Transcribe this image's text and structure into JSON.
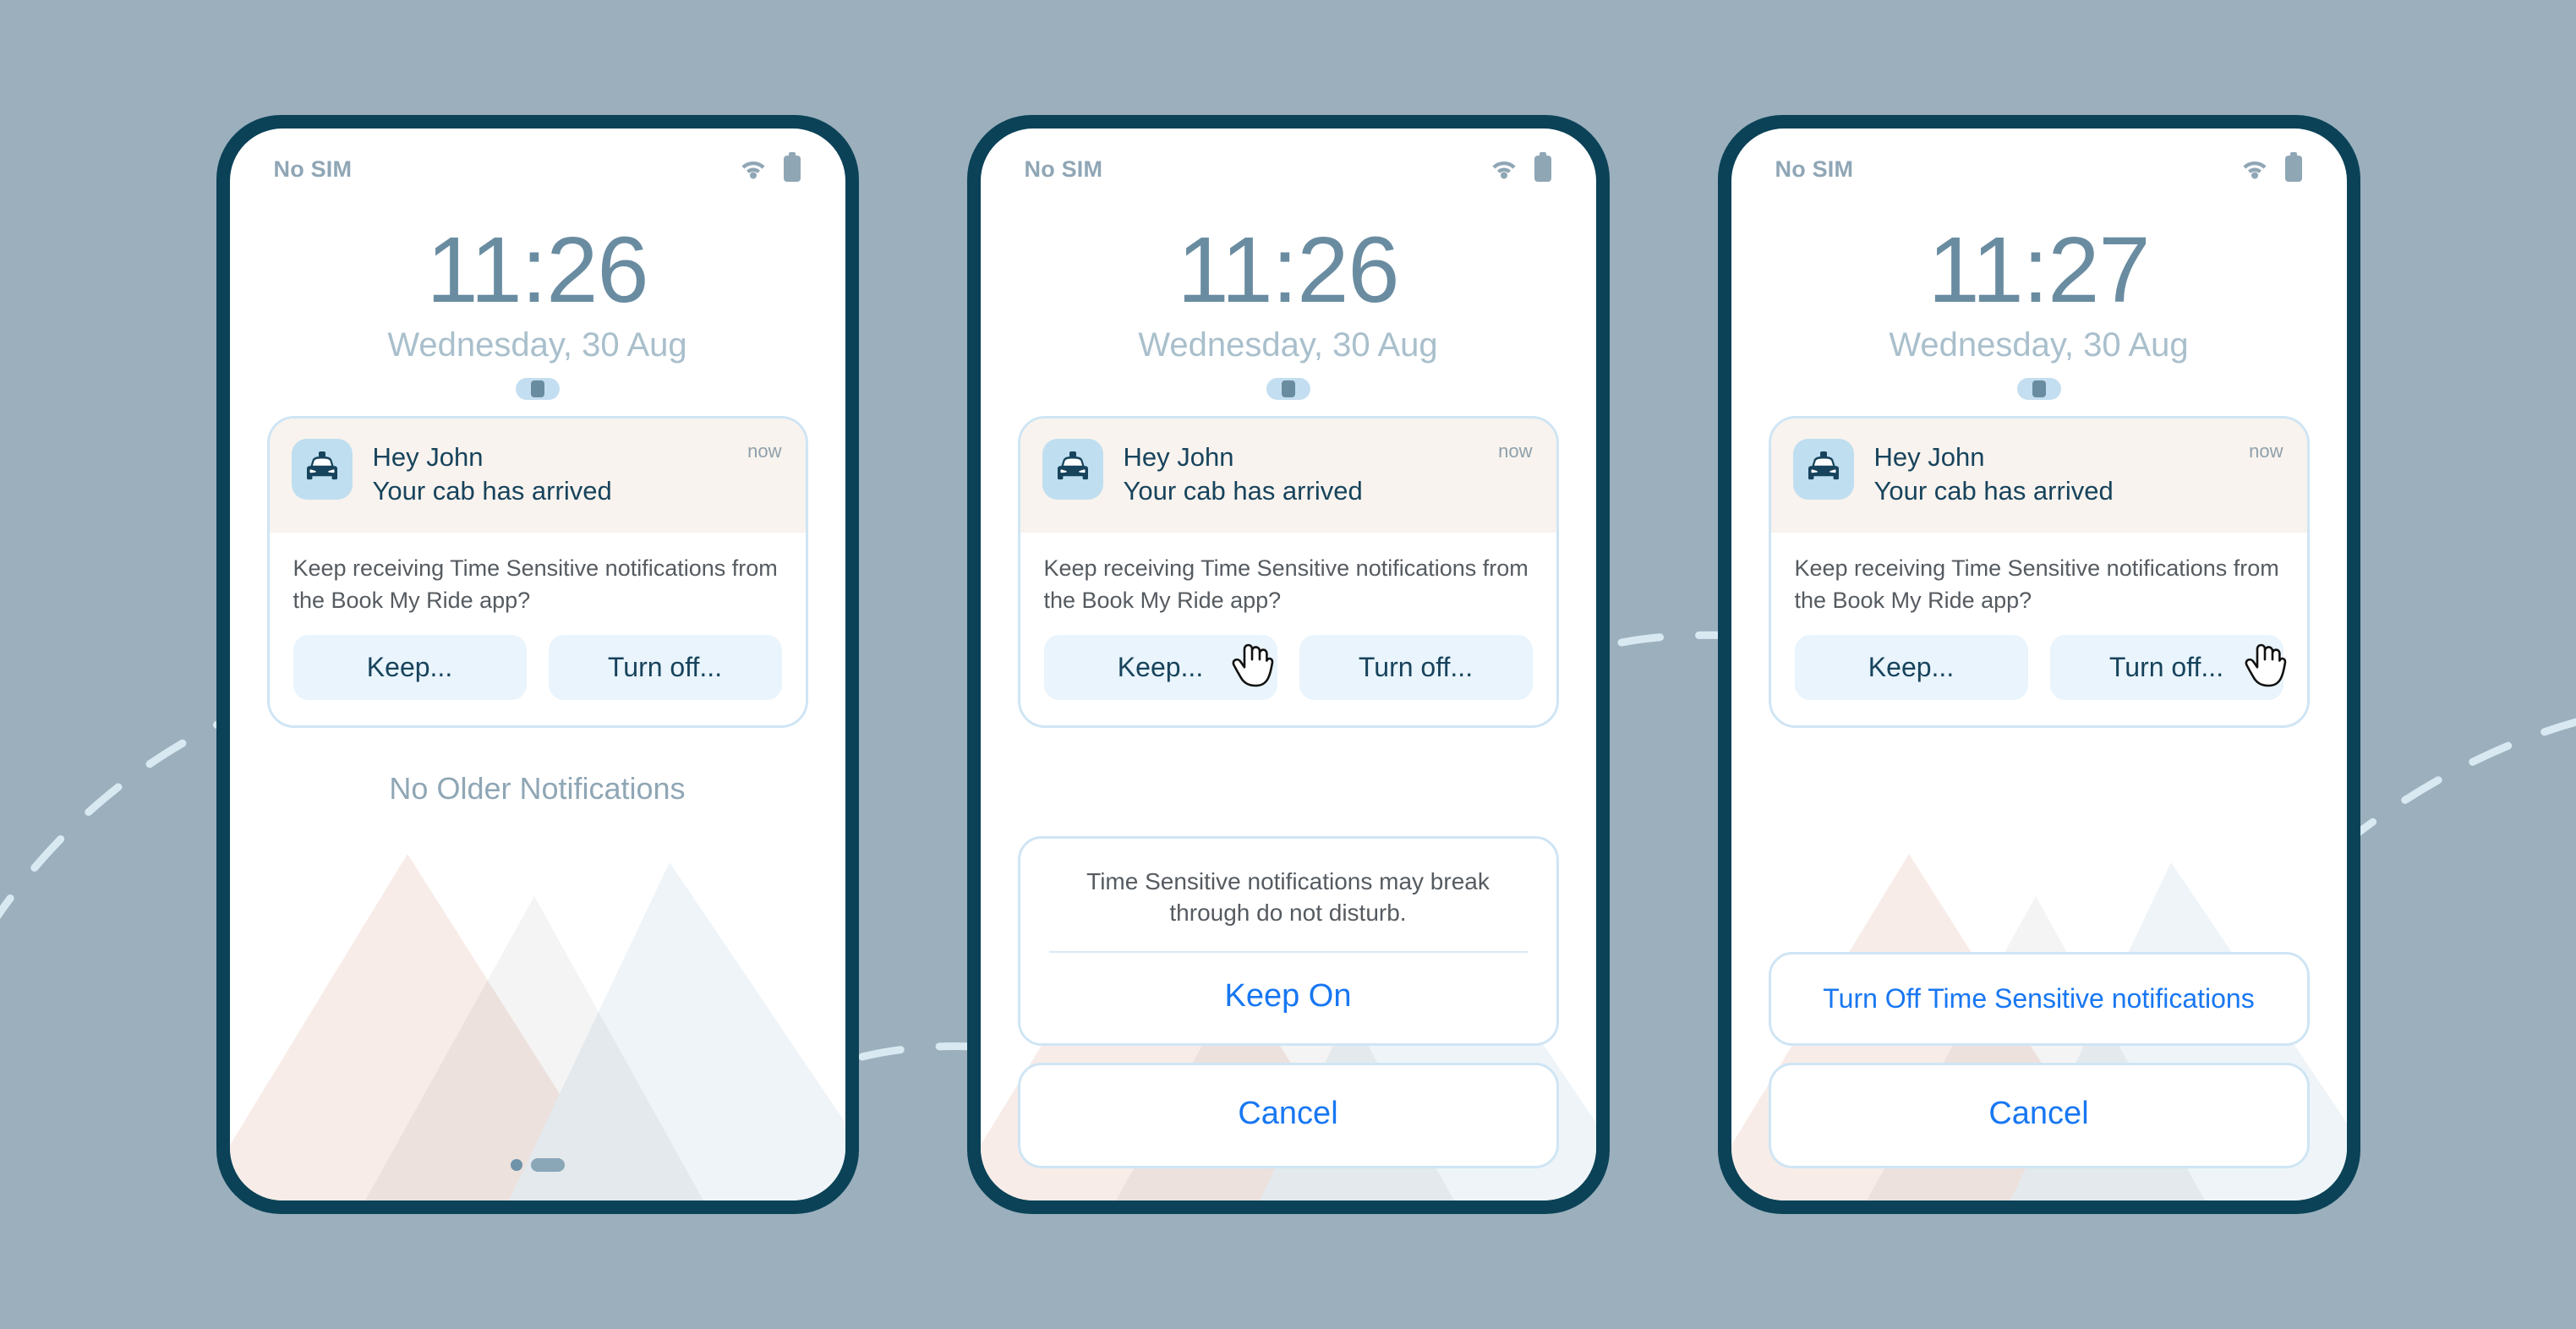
{
  "background": {
    "color": "#9bafbd",
    "accent_frame": "#0b4257",
    "dash_color": "#d8e9f2"
  },
  "phones": [
    {
      "id": "phone-initial",
      "status": {
        "carrier": "No SIM",
        "wifi_icon": "wifi-icon",
        "battery_icon": "battery-icon"
      },
      "lock": {
        "time": "11:26",
        "date": "Wednesday, 30 Aug"
      },
      "notification": {
        "app_icon": "taxi-icon",
        "title": "Hey John",
        "body": "Your cab has arrived",
        "time": "now",
        "prompt": "Keep receiving Time Sensitive notifications from the Book My Ride app?",
        "actions": [
          "Keep...",
          "Turn off..."
        ]
      },
      "empty_state": "No Older Notifications",
      "sheets": [],
      "cursor": null,
      "show_home_dots": true
    },
    {
      "id": "phone-keep-sheet",
      "status": {
        "carrier": "No SIM",
        "wifi_icon": "wifi-icon",
        "battery_icon": "battery-icon"
      },
      "lock": {
        "time": "11:26",
        "date": "Wednesday, 30 Aug"
      },
      "notification": {
        "app_icon": "taxi-icon",
        "title": "Hey John",
        "body": "Your cab has arrived",
        "time": "now",
        "prompt": "Keep receiving Time Sensitive notifications from the Book My Ride app?",
        "actions": [
          "Keep...",
          "Turn off..."
        ]
      },
      "empty_state": null,
      "sheets": [
        {
          "message": "Time Sensitive notifications may break through do not disturb.",
          "buttons": [
            "Keep On"
          ]
        },
        {
          "message": null,
          "buttons": [
            "Cancel"
          ]
        }
      ],
      "cursor": {
        "over": "Keep...",
        "icon": "pointing-hand-cursor"
      },
      "show_home_dots": false
    },
    {
      "id": "phone-turnoff-sheet",
      "status": {
        "carrier": "No SIM",
        "wifi_icon": "wifi-icon",
        "battery_icon": "battery-icon"
      },
      "lock": {
        "time": "11:27",
        "date": "Wednesday, 30 Aug"
      },
      "notification": {
        "app_icon": "taxi-icon",
        "title": "Hey John",
        "body": "Your cab has arrived",
        "time": "now",
        "prompt": "Keep receiving Time Sensitive notifications from the Book My Ride app?",
        "actions": [
          "Keep...",
          "Turn off..."
        ]
      },
      "empty_state": null,
      "sheets": [
        {
          "message": null,
          "buttons": [
            "Turn Off Time Sensitive notifications"
          ]
        },
        {
          "message": null,
          "buttons": [
            "Cancel"
          ]
        }
      ],
      "cursor": {
        "over": "Turn off...",
        "icon": "pointing-hand-cursor"
      },
      "show_home_dots": false
    }
  ]
}
